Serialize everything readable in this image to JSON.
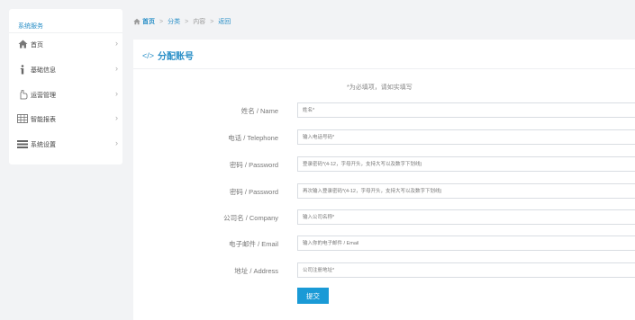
{
  "sidebar": {
    "title": "系统服务",
    "items": [
      {
        "label": "首页",
        "icon": "home-icon"
      },
      {
        "label": "基础信息",
        "icon": "info-icon"
      },
      {
        "label": "运营管理",
        "icon": "hand-icon"
      },
      {
        "label": "智能报表",
        "icon": "table-icon"
      },
      {
        "label": "系统设置",
        "icon": "list-icon"
      }
    ]
  },
  "breadcrumb": [
    "首页",
    "分类",
    "内容",
    "返回"
  ],
  "panel": {
    "title": "分配账号",
    "note": "*为必填项，请如实填写"
  },
  "form": {
    "fields": [
      {
        "label": "姓名 / Name",
        "placeholder": "姓名*"
      },
      {
        "label": "电话 / Telephone",
        "placeholder": "输入电话号码*"
      },
      {
        "label": "密码 / Password",
        "placeholder": "登录密码*(4-12，字母开头，支持大写以及数字下划线)"
      },
      {
        "label": "密码 / Password",
        "placeholder": "再次输入登录密码*(4-12，字母开头，支持大写以及数字下划线)"
      },
      {
        "label": "公司名 / Company",
        "placeholder": "输入公司名称*"
      },
      {
        "label": "电子邮件 / Email",
        "placeholder": "输入你的电子邮件 / Email"
      },
      {
        "label": "地址 / Address",
        "placeholder": "公司注册地址*"
      }
    ],
    "submit_label": "提交"
  },
  "colors": {
    "accent": "#2a8fc7",
    "button": "#1a9ad6",
    "background": "#f2f3f5"
  }
}
